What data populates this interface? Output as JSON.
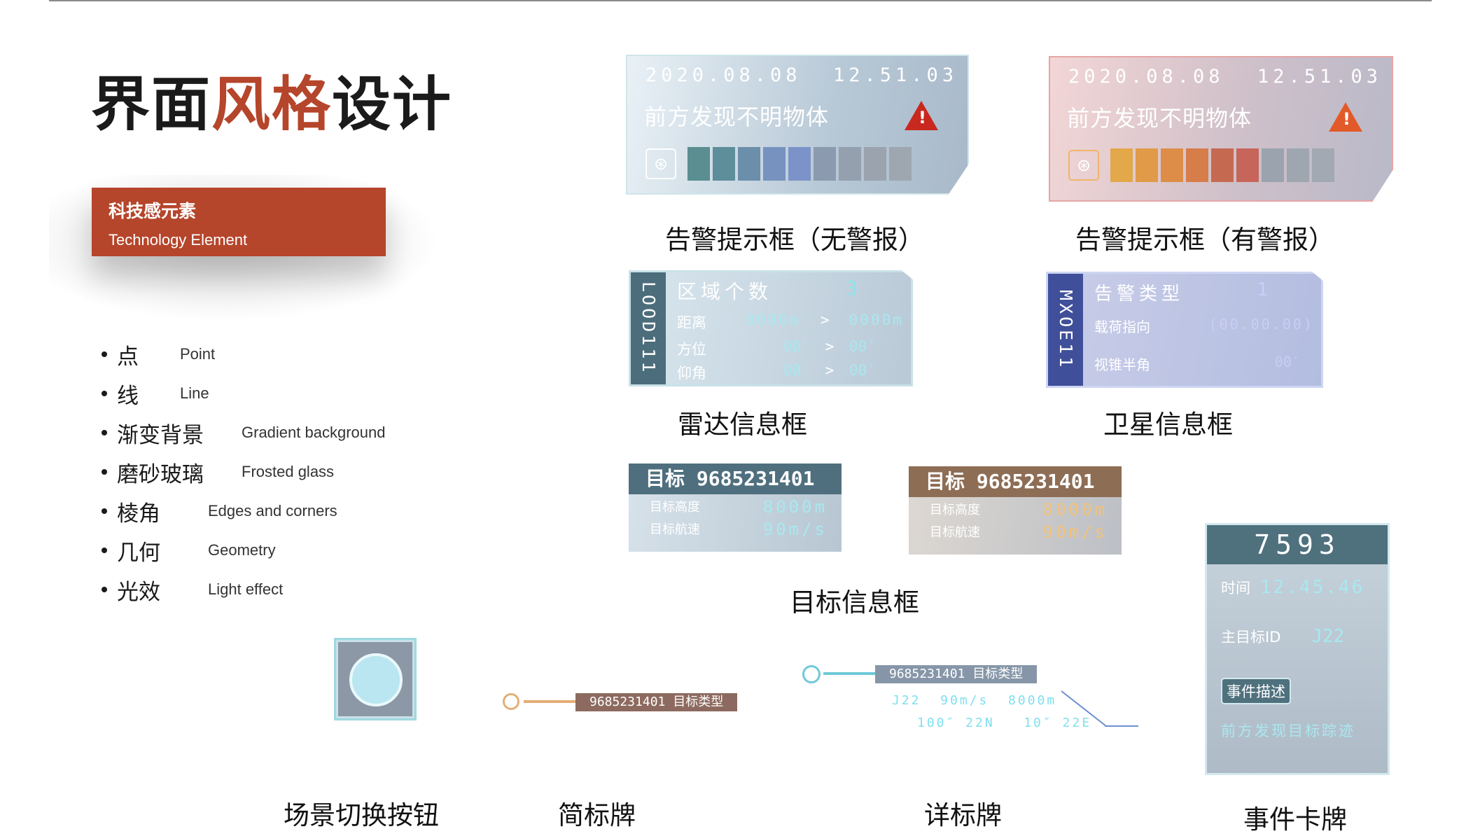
{
  "title_prefix": "界面",
  "title_accent": "风格",
  "title_suffix": "设计",
  "tag": {
    "cn": "科技感元素",
    "en": "Technology Element"
  },
  "bullets": [
    {
      "cn": "点",
      "en": "Point"
    },
    {
      "cn": "线",
      "en": "Line"
    },
    {
      "cn": "渐变背景",
      "en": "Gradient background"
    },
    {
      "cn": "磨砂玻璃",
      "en": "Frosted glass"
    },
    {
      "cn": "棱角",
      "en": "Edges and corners"
    },
    {
      "cn": "几何",
      "en": "Geometry"
    },
    {
      "cn": "光效",
      "en": "Light effect"
    }
  ],
  "alarm_cold": {
    "date": "2020.08.08",
    "time": "12.51.03",
    "message": "前方发现不明物体",
    "label": "告警提示框（无警报）",
    "cells": [
      "#5a8e90",
      "#5d8e9a",
      "#6b8fab",
      "#7892c0",
      "#7b93c8",
      "#8c9ab0",
      "#94a0ae",
      "#9aa3ae",
      "#9ea6b0"
    ]
  },
  "alarm_hot": {
    "date": "2020.08.08",
    "time": "12.51.03",
    "message": "前方发现不明物体",
    "label": "告警提示框（有警报）",
    "cells": [
      "#e2a84a",
      "#e09a48",
      "#de8d48",
      "#d67d4a",
      "#c56a50",
      "#c8655a",
      "#9aa3ae",
      "#9ea6b0",
      "#a2a9b3"
    ]
  },
  "radar": {
    "side": "LOOD111",
    "title": "区域个数",
    "count": "3",
    "rows": [
      {
        "k": "距离",
        "a": "0000m",
        "b": "0000m"
      },
      {
        "k": "方位",
        "a": "00′",
        "b": "00′"
      },
      {
        "k": "仰角",
        "a": "00′",
        "b": "00′"
      }
    ],
    "label": "雷达信息框"
  },
  "satellite": {
    "side": "MXOE11",
    "title": "告警类型",
    "count": "1",
    "rows": [
      {
        "k": "载荷指向",
        "v": "(00.00.00)"
      },
      {
        "k": "视锥半角",
        "v": "00′"
      }
    ],
    "label": "卫星信息框"
  },
  "target_a": {
    "head": "目标 9685231401",
    "r1k": "目标高度",
    "r1v": "8000m",
    "r2k": "目标航速",
    "r2v": "90m/s",
    "color": "#4f6f7e"
  },
  "target_b": {
    "head": "目标 9685231401",
    "r1k": "目标高度",
    "r1v": "8000m",
    "r2k": "目标航速",
    "r2v": "90m/s",
    "color": "#8e6d55"
  },
  "target_label": "目标信息框",
  "event": {
    "id": "7593",
    "time_k": "时间",
    "time_v": "12.45.46",
    "main_k": "主目标ID",
    "main_v": "J22",
    "desc_k": "事件描述",
    "desc_v": "前方发现目标踪迹",
    "label": "事件卡牌"
  },
  "scene_label": "场景切换按钮",
  "simple_tag": {
    "text": "9685231401 目标类型",
    "label": "简标牌"
  },
  "detail_tag": {
    "text": "9685231401 目标类型",
    "l2": "J22  90m/s  8000m",
    "l3": "100″ 22N   10″ 22E",
    "label": "详标牌"
  }
}
